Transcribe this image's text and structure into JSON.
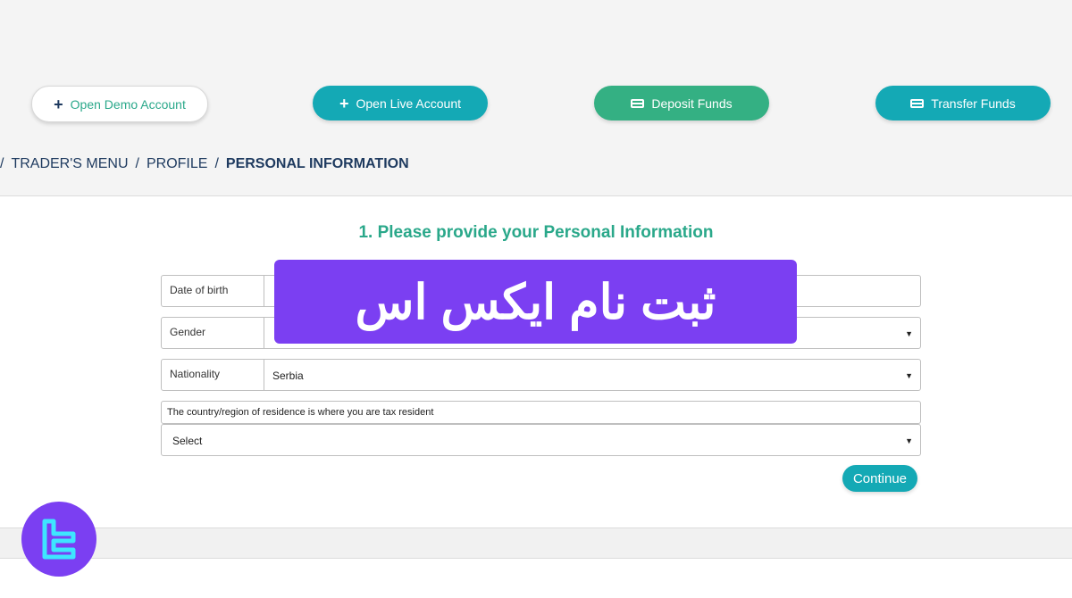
{
  "actions": {
    "open_demo": "Open Demo Account",
    "open_live": "Open Live Account",
    "deposit": "Deposit Funds",
    "transfer": "Transfer Funds"
  },
  "breadcrumb": {
    "lead_sep": "/",
    "items": [
      "TRADER'S MENU",
      "PROFILE",
      "PERSONAL INFORMATION"
    ],
    "sep": "/"
  },
  "form": {
    "heading": "1. Please provide your Personal Information",
    "dob_label": "Date of birth",
    "gender_label": "Gender",
    "nationality_label": "Nationality",
    "nationality_value": "Serbia",
    "residence_note": "The country/region of residence is where you are tax resident",
    "residence_select": "Select",
    "continue_label": "Continue"
  },
  "overlay": {
    "text": "ثبت نام ایکس اس"
  },
  "colors": {
    "teal": "#14a9b5",
    "green": "#34b083",
    "heading_green": "#2aa88a",
    "navy": "#1e3a5f",
    "purple": "#7b3ff2"
  }
}
